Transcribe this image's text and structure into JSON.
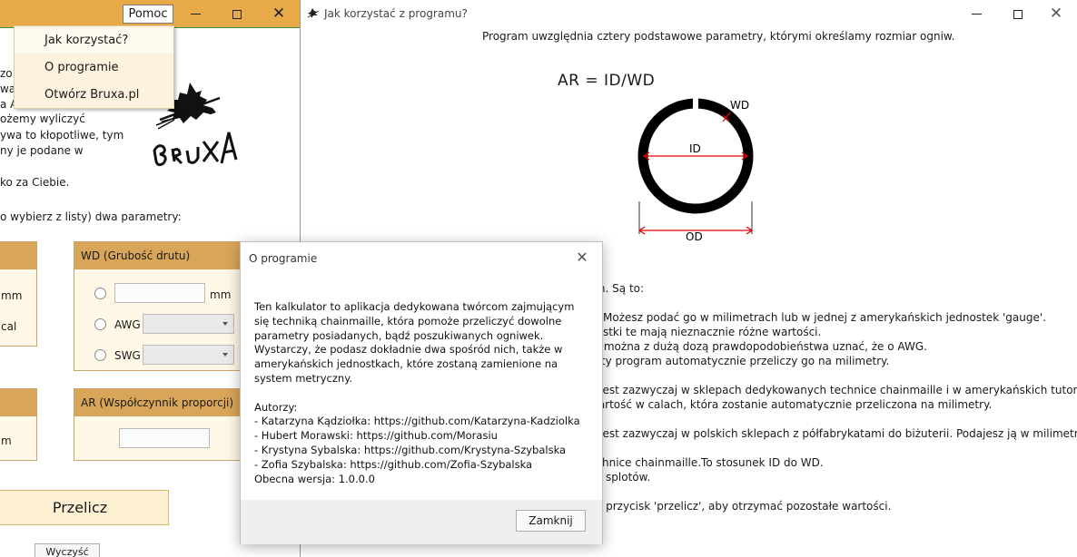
{
  "main_window": {
    "menu_button": "Pomoc",
    "menu_items": [
      "Jak korzystać?",
      "O programie",
      "Otwórz Bruxa.pl"
    ],
    "partial_text": [
      "zo",
      "wa",
      "a A",
      "ożemy wyliczyć",
      "ywa to kłopotliwe, tym",
      "ny je podane w",
      "ko za Ciebie.",
      "o wybierz z listy) dwa parametry:"
    ],
    "logo_text": "BRUXA",
    "wd_group": {
      "title": "WD (Grubość drutu)",
      "unit": "mm",
      "awg_label": "AWG",
      "swg_label": "SWG"
    },
    "left_group_labels": [
      "mm",
      "cal"
    ],
    "ar_group": {
      "title": "AR (Współczynnik proporcji)"
    },
    "left_group2_label": "m",
    "calc_button": "Przelicz",
    "clear_button": "Wyczyść"
  },
  "help_window": {
    "title": "Jak korzystać z programu?",
    "intro": "Program uwzględnia cztery podstawowe parametry, którymi określamy rozmiar ogniw.",
    "formula": "AR = ID/WD",
    "diagram_labels": {
      "wd": "WD",
      "id": "ID",
      "od": "OD"
    },
    "lines": [
      "ich. Są to:",
      "e. Możesz podać go w milimetrach lub w jednej z amerykańskich jednostek 'gauge'.",
      "nostki te mają nieznacznie różne wartości.",
      "to można z dużą dozą prawdopodobieństwa uznać, że o AWG.",
      "listy program automatycznie przeliczy go na milimetry.",
      "a jest zazwyczaj w sklepach dedykowanych technice chainmaille i w amerykańskich tutorialach.",
      "wartość w calach, która zostanie automatycznie przeliczona na milimetry.",
      "a jest zazwyczaj w polskich sklepach z półfabrykatami do biżuterii. Podajesz ją w milimetrach.",
      "echnice chainmaille.To stosunek ID do WD.",
      "ch splotów.",
      "nij przycisk 'przelicz', aby otrzymać pozostałe wartości."
    ]
  },
  "about_dialog": {
    "title": "O programie",
    "description": "Ten kalkulator to aplikacja dedykowana twórcom zajmującym się techniką chainmaille, która pomoże przeliczyć dowolne parametry posiadanych, bądź poszukiwanych ogniwek. Wystarczy, że podasz dokładnie dwa spośród nich, także w amerykańskich jednostkach, które zostaną zamienione na system metryczny.",
    "authors_heading": "Autorzy:",
    "authors": [
      "- Katarzyna Kądziołka: https://github.com/Katarzyna-Kadziolka",
      "- Hubert Morawski: https://github.com/Morasiu",
      "- Krystyna Sybalska: https://github.com/Krystyna-Szybalska",
      "- Zofia Szybalska: https://github.com/Zofia-Szybalska"
    ],
    "version": "Obecna wersja: 1.0.0.0",
    "close_button": "Zamknij"
  },
  "colors": {
    "accent": "#e8a949",
    "group_header": "#d9a558",
    "group_bg": "#fff8e6",
    "menu_bg": "#fcf2dd",
    "diagram_red": "#e00000"
  }
}
